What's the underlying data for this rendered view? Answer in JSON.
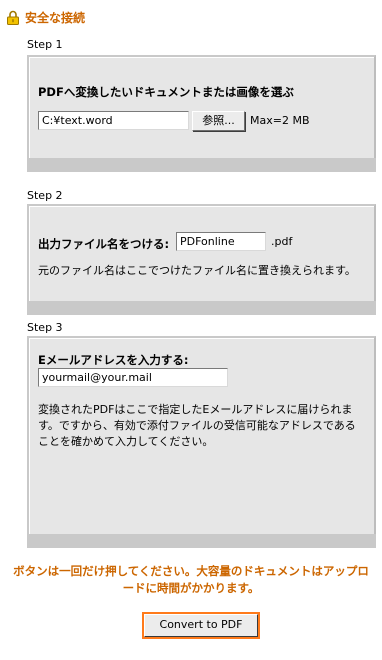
{
  "secure_connection": "安全な接続",
  "colors": {
    "accent": "#cc6600",
    "panel": "#e6e6e6",
    "button_border": "#ff7a1a"
  },
  "step1": {
    "label": "Step 1",
    "heading": "PDFへ変換したいドキュメントまたは画像を選ぶ",
    "file_value": "C:¥text.word",
    "browse_label": "参照...",
    "max_size": "Max=2 MB"
  },
  "step2": {
    "label": "Step 2",
    "filename_label": "出力ファイル名をつける:",
    "filename_value": "PDFonline",
    "extension": ".pdf",
    "note": "元のファイル名はここでつけたファイル名に置き換えられます。"
  },
  "step3": {
    "label": "Step 3",
    "email_label": "Eメールアドレスを入力する:",
    "email_value": "yourmail@your.mail",
    "note": "変換されたPDFはここで指定したEメールアドレスに届けられます。ですから、有効で添付ファイルの受信可能なアドレスであることを確かめて入力してください。"
  },
  "notice": "ボタンは一回だけ押してください。大容量のドキュメントはアップロードに時間がかかります。",
  "convert_button": "Convert to PDF"
}
